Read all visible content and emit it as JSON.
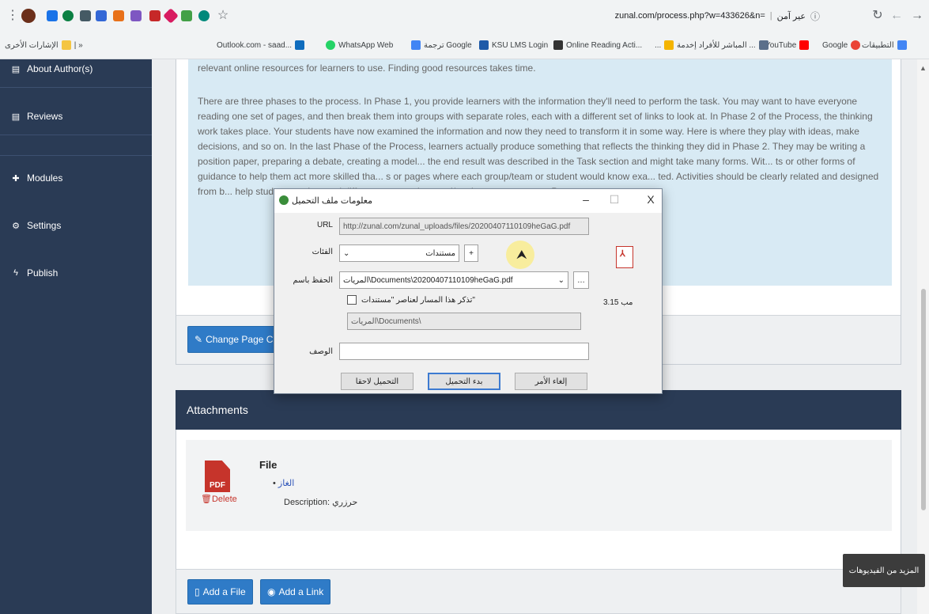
{
  "browser": {
    "address_url": "zunal.com/process.php?w=433626&n=",
    "address_site_label": "عير آمن",
    "bookmarks": [
      {
        "label": "التطبيقات",
        "color": "#4285f4"
      },
      {
        "label": "Google",
        "color": "#ea4335"
      },
      {
        "label": "YouTube",
        "color": "#ff0000"
      },
      {
        "label": "المباشر للأفراد إخدمة ...",
        "color": "#5b6f8a"
      },
      {
        "label": "...",
        "color": "#f4b400"
      },
      {
        "label": "Online Reading Acti...",
        "color": "#333333"
      },
      {
        "label": "KSU LMS Login",
        "color": "#1e5aa8"
      },
      {
        "label": "ترجمة Google",
        "color": "#4285f4"
      },
      {
        "label": "WhatsApp Web",
        "color": "#25d366"
      },
      {
        "label": "Outlook.com - saad...",
        "color": "#0f6cbd"
      },
      {
        "label": "الإشارات الأخرى",
        "color": "#f4c542"
      }
    ]
  },
  "sidebar": {
    "items": [
      {
        "label": "About Author(s)",
        "icon": "document-icon"
      },
      {
        "label": "Reviews",
        "icon": "document-icon"
      },
      {
        "label": "Modules",
        "icon": "plus-icon"
      },
      {
        "label": "Settings",
        "icon": "gear-icon"
      },
      {
        "label": "Publish",
        "icon": "bolt-icon"
      }
    ]
  },
  "process": {
    "para1": "relevant online resources for learners to use. Finding good resources takes time.",
    "para2": "There are three phases to the process. In Phase 1, you provide learners with the information they'll need to perform the task. You may want to have everyone reading one set of pages, and then break them into groups with separate roles, each with a different set of links to look at. In Phase 2 of the Process, the thinking work takes place. Your students have now examined the information and now they need to transform it in some way. Here is where they play with ideas, make decisions, and so on. In the last Phase of the Process, learners actually produce something that reflects the thinking they did in Phase 2. They may be writing a position paper, preparing a debate, creating a model... the end result was described in the Task section and might take many forms. Wit... ts or other forms of guidance to help them act more skilled tha... s or pages where each group/team or student would know exa... ted. Activities should be clearly related and designed from b... help students understand different perspectives and/or share res... art your Process page.",
    "change_button": "Change Page C"
  },
  "attachments": {
    "header": "Attachments",
    "file_heading": "File",
    "file_link": "الغاز",
    "description_label": "Description:",
    "description_value": "حرزري",
    "delete_label": "Delete",
    "pdf_label": "PDF",
    "add_file": "Add a File",
    "add_link": "Add a Link"
  },
  "dialog": {
    "title": "معلومات ملف التحميل",
    "url_label": "URL",
    "url_value": "http://zunal.com/zunal_uploads/files/20200407110109heGaG.pdf",
    "category_label": "الفئات",
    "category_value": "مستندات",
    "save_as_label": "الحفظ باسم",
    "save_as_value": "المريات\\Documents\\20200407110109heGaG.pdf",
    "remember_label": "تذكر هذا المسار لعناصر \"مستندات\"",
    "path_value": "المريات\\Documents\\",
    "description_label": "الوصف",
    "size_value": "3.15 مب",
    "btn_later": "التحميل لاحقا",
    "btn_start": "بدء التحميل",
    "btn_cancel": "إلغاء الأمر",
    "close_glyph": "X",
    "minimize_glyph": "–",
    "maximize_glyph": "☐"
  },
  "tooltip": "المزيد من الفيديوهات"
}
